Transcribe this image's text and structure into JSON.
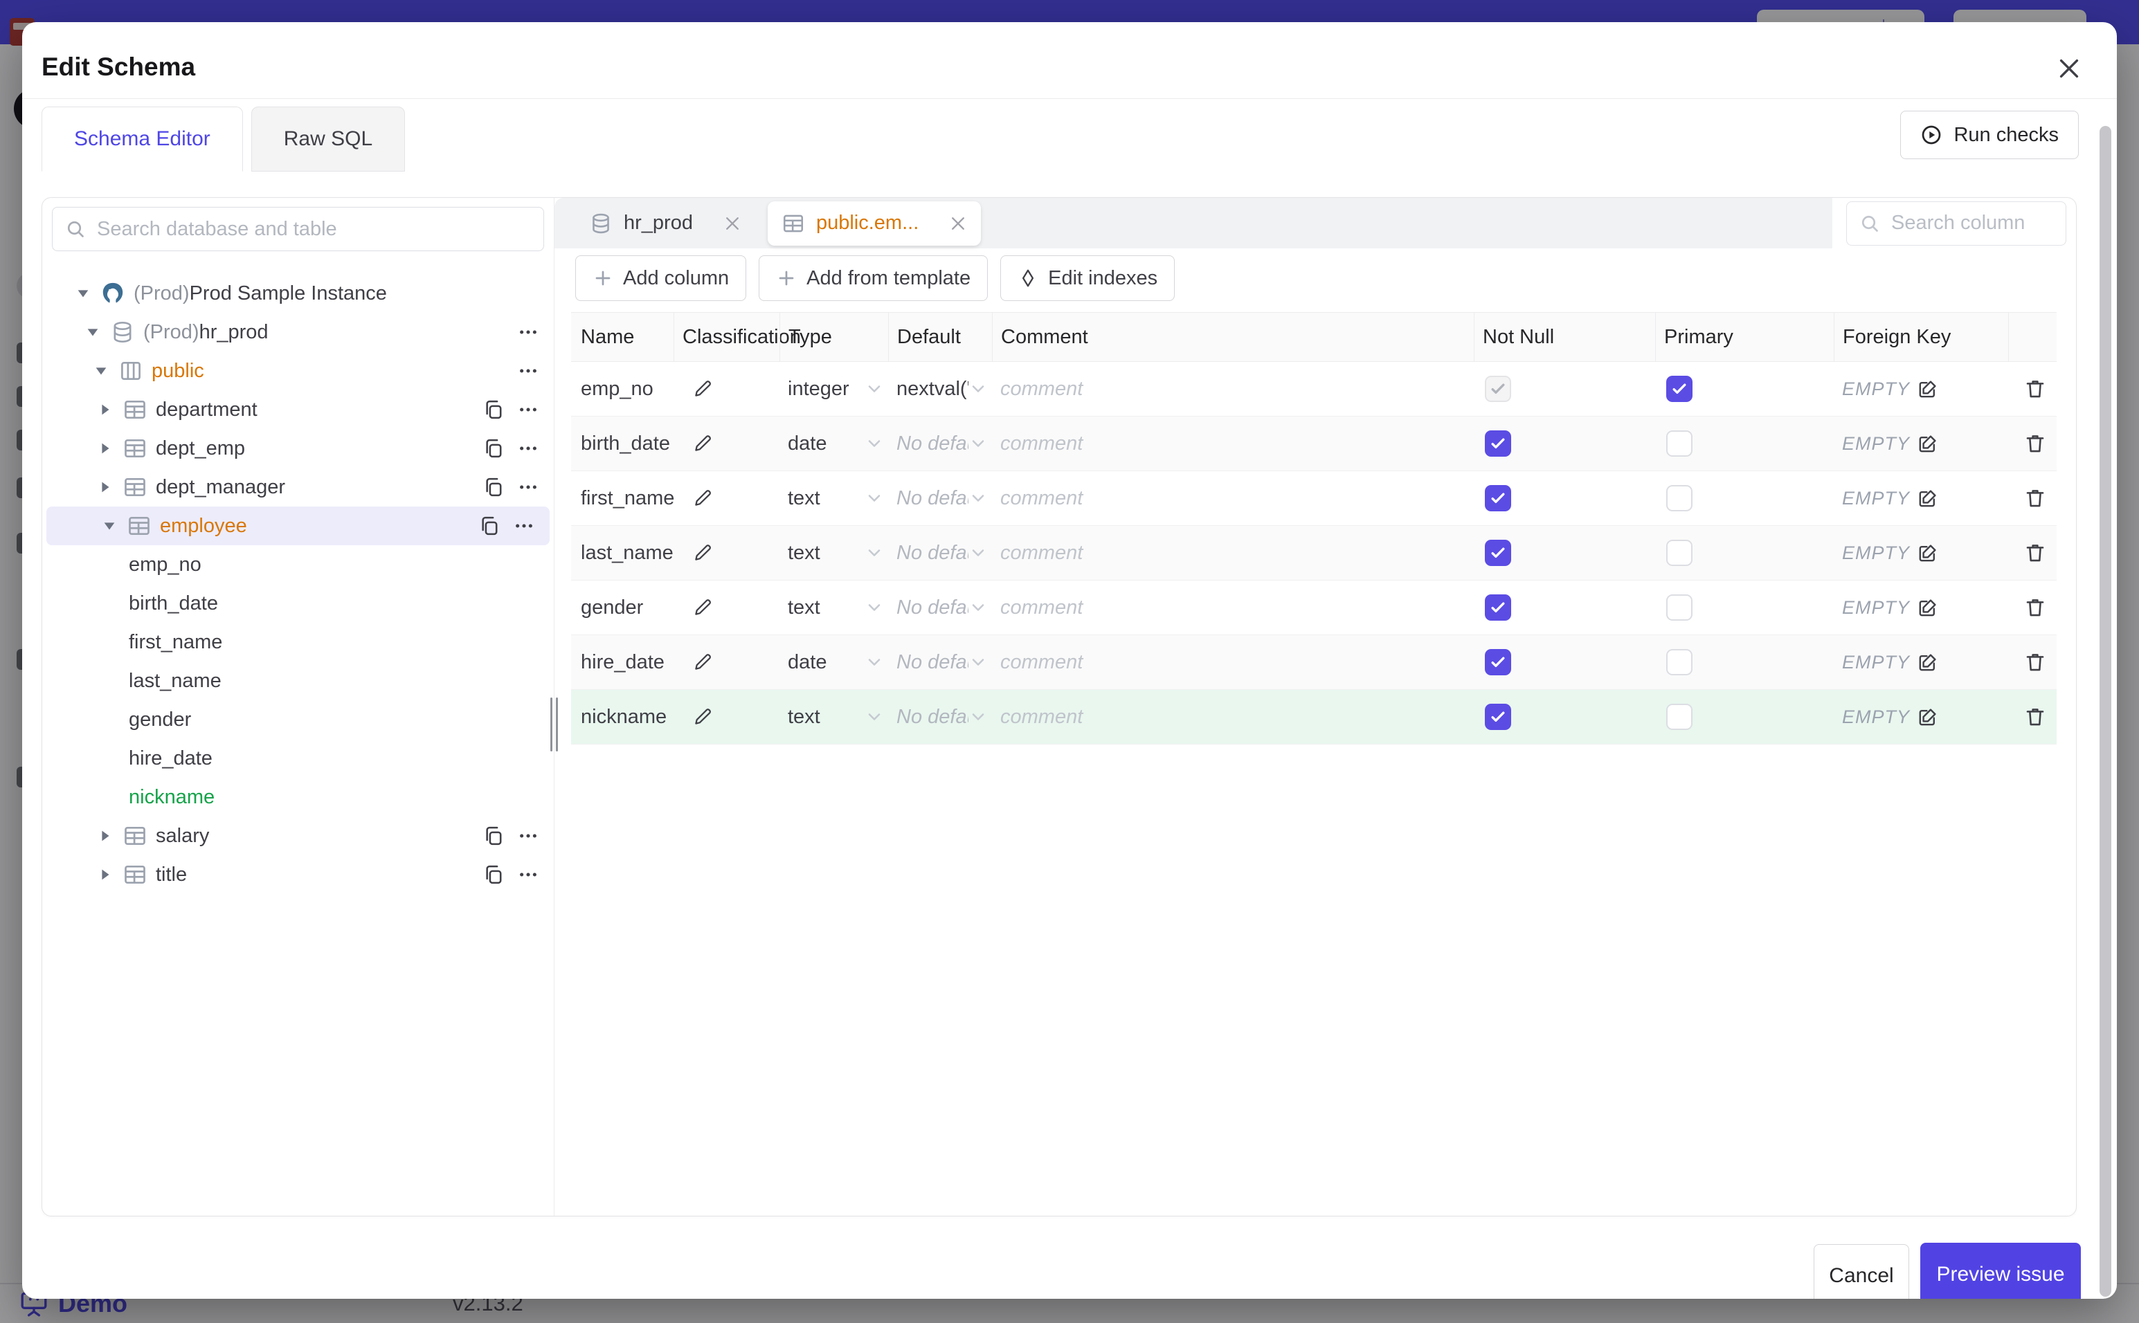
{
  "app": {
    "footer": {
      "brand": "Demo",
      "version": "v2.13.2"
    }
  },
  "modal": {
    "title": "Edit Schema",
    "tabs": [
      {
        "label": "Schema Editor",
        "active": true
      },
      {
        "label": "Raw SQL",
        "active": false
      }
    ],
    "run_checks_label": "Run checks",
    "sidebar": {
      "search_placeholder": "Search database and table",
      "tree": [
        {
          "prefix": "(Prod) ",
          "label": "Prod Sample Instance",
          "icon": "postgres",
          "level": 0
        },
        {
          "prefix": "(Prod) ",
          "label": "hr_prod",
          "icon": "database",
          "level": 1,
          "menu": true
        },
        {
          "label": "public",
          "icon": "schema",
          "level": 2,
          "menu": true,
          "accent": "amber"
        },
        {
          "label": "department",
          "icon": "table",
          "level": 3,
          "copy": true,
          "menu": true
        },
        {
          "label": "dept_emp",
          "icon": "table",
          "level": 3,
          "copy": true,
          "menu": true
        },
        {
          "label": "dept_manager",
          "icon": "table",
          "level": 3,
          "copy": true,
          "menu": true
        },
        {
          "label": "employee",
          "icon": "table",
          "level": 3,
          "copy": true,
          "menu": true,
          "selected": true,
          "accent": "amber"
        },
        {
          "label": "emp_no",
          "level": 4
        },
        {
          "label": "birth_date",
          "level": 4
        },
        {
          "label": "first_name",
          "level": 4
        },
        {
          "label": "last_name",
          "level": 4
        },
        {
          "label": "gender",
          "level": 4
        },
        {
          "label": "hire_date",
          "level": 4
        },
        {
          "label": "nickname",
          "level": 4,
          "accent": "green"
        },
        {
          "label": "salary",
          "icon": "table",
          "level": 3,
          "copy": true,
          "menu": true
        },
        {
          "label": "title",
          "icon": "table",
          "level": 3,
          "copy": true,
          "menu": true
        }
      ]
    },
    "editor": {
      "chips": [
        {
          "label": "hr_prod",
          "icon": "database",
          "active": false
        },
        {
          "label": "public.em...",
          "icon": "table",
          "active": true
        }
      ],
      "column_search_placeholder": "Search column",
      "toolbar": {
        "add_column": "Add column",
        "add_from_template": "Add from template",
        "edit_indexes": "Edit indexes"
      },
      "table": {
        "headers": [
          "Name",
          "Classification",
          "Type",
          "Default",
          "Comment",
          "Not Null",
          "Primary",
          "Foreign Key"
        ],
        "comment_placeholder": "comment",
        "fk_empty_label": "EMPTY",
        "rows": [
          {
            "name": "emp_no",
            "type": "integer",
            "default": "nextval('employ",
            "default_is_placeholder": false,
            "not_null": "disabled-checked",
            "primary": true,
            "highlight": false
          },
          {
            "name": "birth_date",
            "type": "date",
            "default": "No default",
            "default_is_placeholder": true,
            "not_null": "checked",
            "primary": false,
            "highlight": false
          },
          {
            "name": "first_name",
            "type": "text",
            "default": "No default",
            "default_is_placeholder": true,
            "not_null": "checked",
            "primary": false,
            "highlight": false
          },
          {
            "name": "last_name",
            "type": "text",
            "default": "No default",
            "default_is_placeholder": true,
            "not_null": "checked",
            "primary": false,
            "highlight": false
          },
          {
            "name": "gender",
            "type": "text",
            "default": "No default",
            "default_is_placeholder": true,
            "not_null": "checked",
            "primary": false,
            "highlight": false
          },
          {
            "name": "hire_date",
            "type": "date",
            "default": "No default",
            "default_is_placeholder": true,
            "not_null": "checked",
            "primary": false,
            "highlight": false
          },
          {
            "name": "nickname",
            "type": "text",
            "default": "No default",
            "default_is_placeholder": true,
            "not_null": "checked",
            "primary": false,
            "highlight": true
          }
        ]
      }
    },
    "footer": {
      "cancel": "Cancel",
      "submit": "Preview issue"
    }
  },
  "colors": {
    "accent": "#4f46e5",
    "checkbox": "#5b4ce4",
    "primary_button": "#5143e3",
    "amber": "#d97706",
    "green": "#16a34a",
    "green_row_bg": "#e9f7ef",
    "selected_row_bg": "#edecfb",
    "topbar": "#504af0"
  }
}
